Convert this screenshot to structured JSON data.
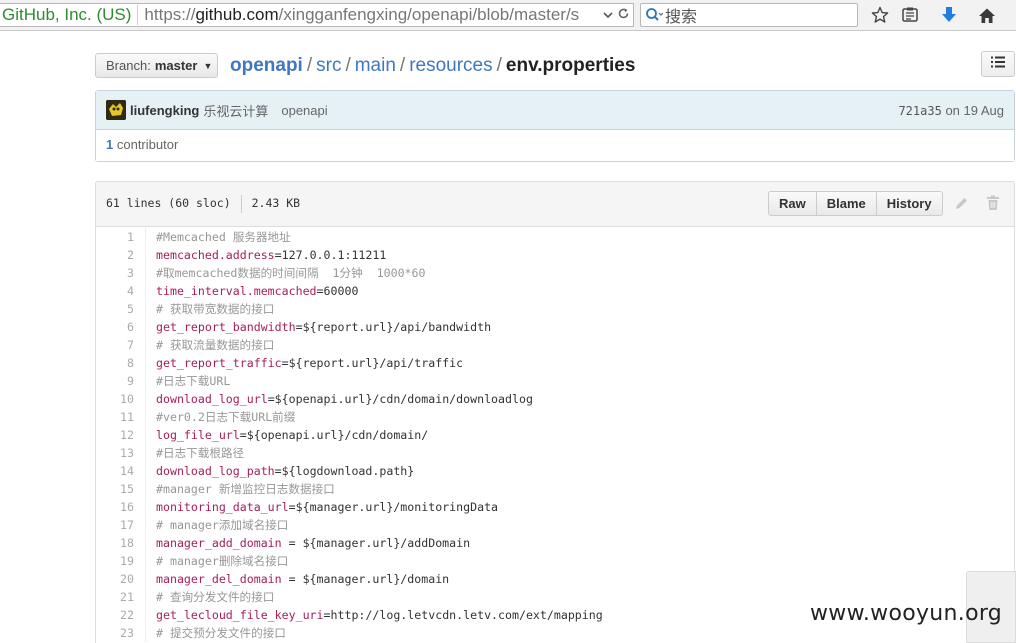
{
  "browser": {
    "site_identity": "GitHub, Inc. (US)",
    "url_prefix": "https://",
    "url_host": "github.com",
    "url_path": "/xingganfengxing/openapi/blob/master/s",
    "search_placeholder": "搜索"
  },
  "repo": {
    "branch_label": "Branch:",
    "branch_value": "master",
    "breadcrumb": {
      "root": "openapi",
      "parts": [
        "src",
        "main",
        "resources"
      ],
      "separator": "/",
      "file": "env.properties"
    }
  },
  "commit": {
    "author": "liufengking",
    "author_org": "乐视云计算",
    "message": "openapi",
    "sha": "721a35",
    "date": "on 19 Aug",
    "contributor_count": "1",
    "contributor_label": "contributor"
  },
  "file": {
    "lines_info": "61 lines (60 sloc)",
    "size": "2.43 KB",
    "buttons": {
      "raw": "Raw",
      "blame": "Blame",
      "history": "History"
    },
    "code": [
      {
        "n": "1",
        "comment": "#Memcached 服务器地址"
      },
      {
        "n": "2",
        "key": "memcached.address",
        "value": "=127.0.0.1:11211"
      },
      {
        "n": "3",
        "comment": "#取memcached数据的时间间隔  1分钟  1000*60"
      },
      {
        "n": "4",
        "key": "time_interval.memcached",
        "value": "=60000"
      },
      {
        "n": "5",
        "comment": "# 获取带宽数据的接口"
      },
      {
        "n": "6",
        "key": "get_report_bandwidth",
        "value": "=${report.url}/api/bandwidth"
      },
      {
        "n": "7",
        "comment": "# 获取流量数据的接口"
      },
      {
        "n": "8",
        "key": "get_report_traffic",
        "value": "=${report.url}/api/traffic"
      },
      {
        "n": "9",
        "comment": "#日志下载URL"
      },
      {
        "n": "10",
        "key": "download_log_url",
        "value": "=${openapi.url}/cdn/domain/downloadlog"
      },
      {
        "n": "11",
        "comment": "#ver0.2日志下载URL前缀"
      },
      {
        "n": "12",
        "key": "log_file_url",
        "value": "=${openapi.url}/cdn/domain/"
      },
      {
        "n": "13",
        "comment": "#日志下载根路径"
      },
      {
        "n": "14",
        "key": "download_log_path",
        "value": "=${logdownload.path}"
      },
      {
        "n": "15",
        "comment": "#manager 新增监控日志数据接口"
      },
      {
        "n": "16",
        "key": "monitoring_data_url",
        "value": "=${manager.url}/monitoringData"
      },
      {
        "n": "17",
        "comment": "# manager添加域名接口"
      },
      {
        "n": "18",
        "key": "manager_add_domain",
        "value": " = ${manager.url}/addDomain"
      },
      {
        "n": "19",
        "comment": "# manager删除域名接口"
      },
      {
        "n": "20",
        "key": "manager_del_domain",
        "value": " = ${manager.url}/domain"
      },
      {
        "n": "21",
        "comment": "# 查询分发文件的接口"
      },
      {
        "n": "22",
        "key": "get_lecloud_file_key_uri",
        "value": "=http://log.letvcdn.letv.com/ext/mapping"
      },
      {
        "n": "23",
        "comment": "# 提交预分发文件的接口"
      }
    ]
  },
  "watermark": "www.wooyun.org"
}
